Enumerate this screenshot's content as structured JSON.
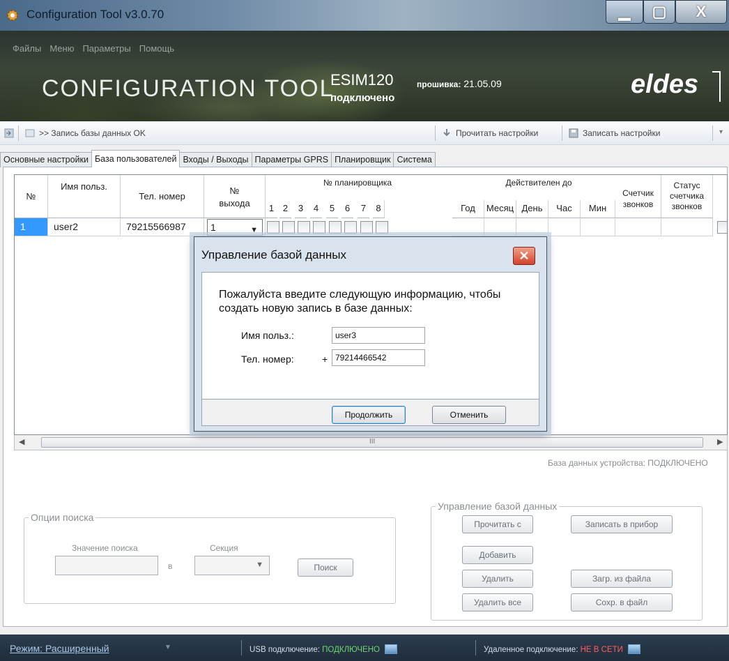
{
  "window": {
    "title": "Configuration Tool v3.0.70",
    "minimize": "▁",
    "maximize": "▢",
    "close": "X"
  },
  "menu": [
    "Файлы",
    "Меню",
    "Параметры",
    "Помощь"
  ],
  "banner": {
    "title": "CONFIGURATION TOOL",
    "device": "ESIM120",
    "device_status": "подключено",
    "firmware_label": "прошивка:",
    "firmware_value": "21.05.09",
    "brand": "eldes"
  },
  "toolbar": {
    "status": ">> Запись базы данных OK",
    "read_settings": "Прочитать настройки",
    "write_settings": "Записать настройки",
    "more": "▾"
  },
  "tabs": [
    "Основные настройки",
    "База пользователей",
    "Входы / Выходы",
    "Параметры GPRS",
    "Планировщик",
    "Система"
  ],
  "active_tab": "База пользователей",
  "grid": {
    "headers": {
      "num": "№",
      "name": "Имя польз.",
      "phone": "Тел. номер",
      "output": "№ выхода",
      "scheduler_group": "№ планировщика",
      "scheduler_cols": [
        "1",
        "2",
        "3",
        "4",
        "5",
        "6",
        "7",
        "8"
      ],
      "valid_group": "Действителен до",
      "valid_cols": [
        "Год",
        "Месяц",
        "День",
        "Час",
        "Мин"
      ],
      "counter": "Счетчик звонков",
      "counter_status": "Статус счетчика звонков"
    },
    "rows": [
      {
        "num": "1",
        "name": "user2",
        "phone": "79215566987",
        "output": "1"
      }
    ],
    "scroll_mark": "III",
    "left_arrow": "◀",
    "right_arrow": "▶",
    "combo_arrow": "▼"
  },
  "db_status": "База данных устройства: ПОДКЛЮЧЕНО",
  "search": {
    "legend": "Опции поиска",
    "value_label": "Значение поиска",
    "in_label": "в",
    "section_label": "Секция",
    "button": "Поиск"
  },
  "db_management": {
    "legend": "Управление базой данных",
    "read": "Прочитать с",
    "write": "Записать в прибор",
    "add": "Добавить",
    "delete": "Удалить",
    "load": "Загр. из файла",
    "delete_all": "Удалить все",
    "save": "Сохр. в файл"
  },
  "statusbar": {
    "mode": "Режим: Расширенный",
    "usb_label": "USB подключение:",
    "usb_value": "ПОДКЛЮЧЕНО",
    "remote_label": "Удаленное подключение:",
    "remote_value": "НЕ В СЕТИ"
  },
  "dialog": {
    "title": "Управление базой данных",
    "prompt": "Пожалуйста введите следующую информацию, чтобы создать новую запись в базе данных:",
    "name_label": "Имя польз.:",
    "name_value": "user3",
    "phone_label": "Тел. номер:",
    "phone_prefix": "+",
    "phone_value": "79214466542",
    "continue": "Продолжить",
    "cancel": "Отменить",
    "close": "✕"
  }
}
